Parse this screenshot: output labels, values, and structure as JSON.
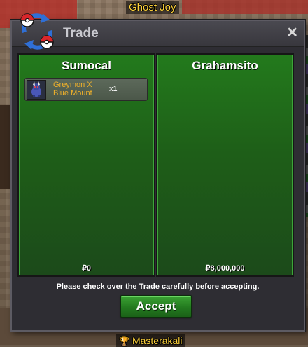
{
  "overlay": {
    "top_player_name": "Ghost Joy",
    "bottom_player_name": "Masterakali"
  },
  "window": {
    "title": "Trade",
    "close_glyph": "✕",
    "icon": "trade-pokeball-arrows-icon"
  },
  "left_panel": {
    "player": "Sumocal",
    "items": [
      {
        "name": "Greymon X Blue Mount",
        "quantity": "x1",
        "icon": "greymon-mount-icon"
      }
    ],
    "money": "₽0"
  },
  "right_panel": {
    "player": "Grahamsito",
    "items": [],
    "money": "₽8,000,000"
  },
  "notice": "Please check over the Trade carefully before accepting.",
  "accept_label": "Accept",
  "colors": {
    "panel_green": "#237a1c",
    "accept_green": "#3ca334",
    "item_name": "#f0b12a",
    "window_bg": "#2e2d33",
    "name_tag": "#ffd23a"
  }
}
